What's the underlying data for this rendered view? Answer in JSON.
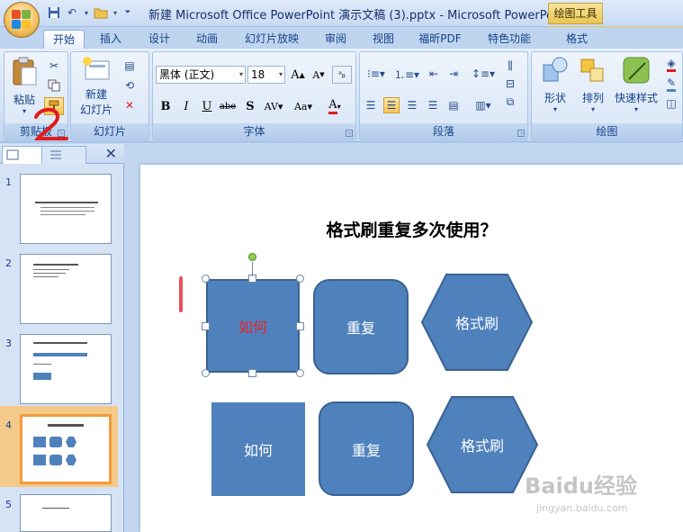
{
  "titlebar": {
    "title": "新建 Microsoft Office PowerPoint 演示文稿 (3).pptx - Microsoft PowerPoint",
    "context_tab_title": "绘图工具"
  },
  "tabs": [
    {
      "label": "开始",
      "active": true
    },
    {
      "label": "插入"
    },
    {
      "label": "设计"
    },
    {
      "label": "动画"
    },
    {
      "label": "幻灯片放映"
    },
    {
      "label": "审阅"
    },
    {
      "label": "视图"
    },
    {
      "label": "福昕PDF"
    },
    {
      "label": "特色功能"
    },
    {
      "label": "格式"
    }
  ],
  "ribbon": {
    "clipboard": {
      "label": "剪贴板",
      "paste": "粘贴"
    },
    "slides": {
      "label": "幻灯片",
      "new_slide_line1": "新建",
      "new_slide_line2": "幻灯片"
    },
    "font": {
      "label": "字体",
      "font_name": "黑体 (正文)",
      "font_size": "18"
    },
    "paragraph": {
      "label": "段落"
    },
    "drawing": {
      "label": "绘图",
      "shapes": "形状",
      "arrange": "排列",
      "quick_styles": "快速样式"
    }
  },
  "annotation": {
    "number": "2"
  },
  "slides_pane": {
    "numbers": [
      "1",
      "2",
      "3",
      "4",
      "5"
    ],
    "selected": "4"
  },
  "slide": {
    "title": "格式刷重复多次使用？",
    "row1": [
      "如何",
      "重复",
      "格式刷"
    ],
    "row2": [
      "如何",
      "重复",
      "格式刷"
    ],
    "shape_fill": "#4f81bd",
    "selected_text_color": "#e8232c"
  },
  "watermark": {
    "brand": "Baidu经验",
    "url": "jingyan.baidu.com"
  }
}
